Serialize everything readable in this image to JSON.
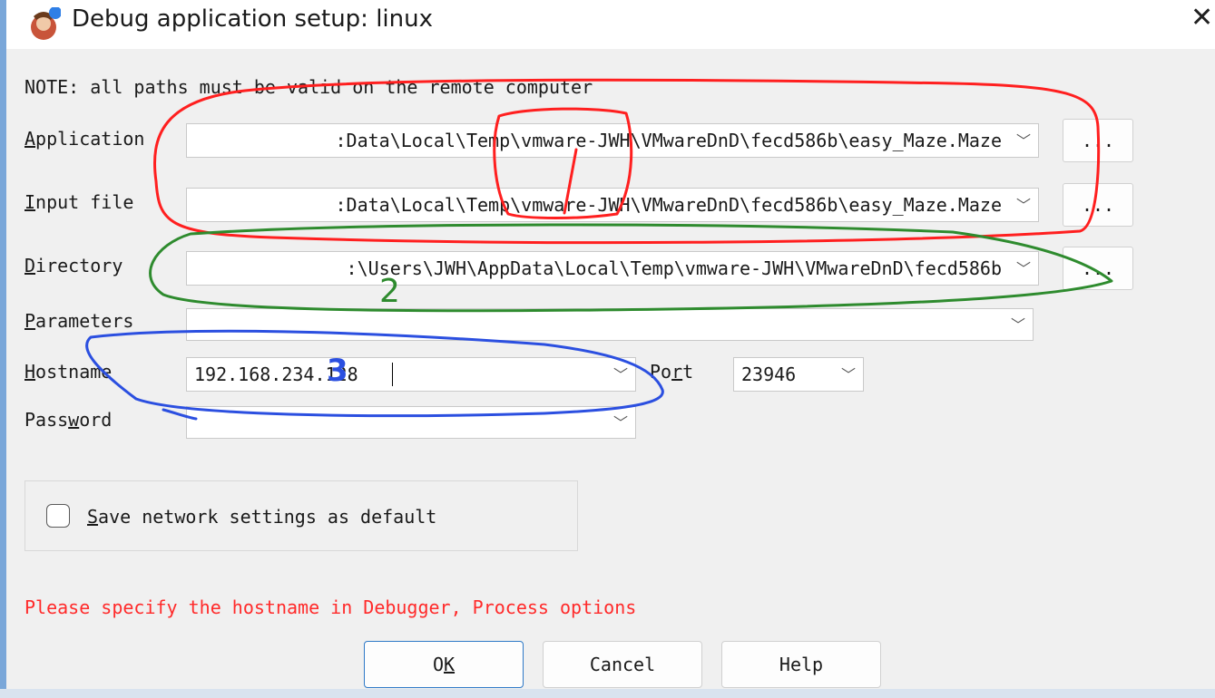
{
  "window": {
    "title": "Debug application setup: linux",
    "close_label": "✕"
  },
  "note": "NOTE: all paths must be valid on the remote computer",
  "labels": {
    "application_u": "A",
    "application_rest": "pplication",
    "input_u": "I",
    "input_rest": "nput file",
    "directory_u": "D",
    "directory_rest": "irectory",
    "parameters_u": "P",
    "parameters_rest": "arameters",
    "hostname_u": "H",
    "hostname_rest": "ostname",
    "password_pre": "Pass",
    "password_u": "w",
    "password_rest": "ord",
    "port_pre": "Po",
    "port_u": "r",
    "port_rest": "t"
  },
  "fields": {
    "application": ":Data\\Local\\Temp\\vmware-JWH\\VMwareDnD\\fecd586b\\easy_Maze.Maze",
    "input_file": ":Data\\Local\\Temp\\vmware-JWH\\VMwareDnD\\fecd586b\\easy_Maze.Maze",
    "directory": ":\\Users\\JWH\\AppData\\Local\\Temp\\vmware-JWH\\VMwareDnD\\fecd586b",
    "parameters": "",
    "hostname": "192.168.234.128",
    "port": "23946",
    "password": ""
  },
  "browse_label": "...",
  "dropdown_glyph": "﹀",
  "checkbox": {
    "label_u": "S",
    "label_rest": "ave network settings as default",
    "checked": false
  },
  "error": "Please specify the hostname in Debugger, Process options",
  "buttons": {
    "ok_pre": "O",
    "ok_u": "K",
    "cancel": "Cancel",
    "help": "Help"
  },
  "annotation_colors": {
    "red": "#ff1f1f",
    "green": "#2e8b2e",
    "blue": "#2b4fe0"
  },
  "annotation_text": {
    "green_mark": "2",
    "blue_mark": "3"
  }
}
